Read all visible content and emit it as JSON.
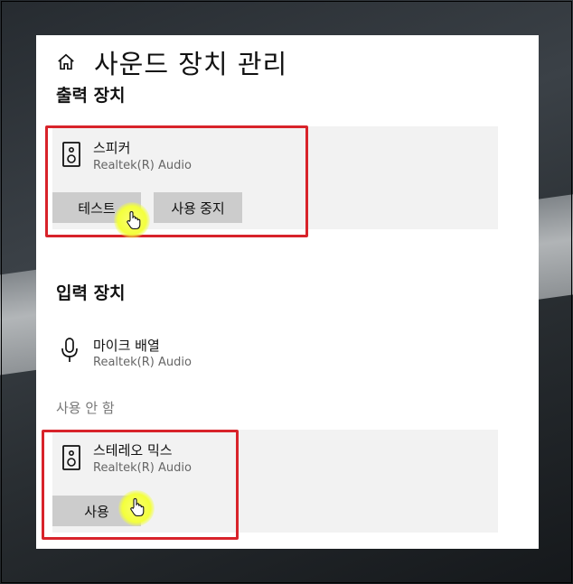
{
  "page": {
    "title": "사운드 장치 관리",
    "home_icon": "home-icon"
  },
  "output": {
    "section_title": "출력 장치",
    "device": {
      "name": "스피커",
      "driver": "Realtek(R) Audio",
      "icon": "speaker-icon",
      "buttons": {
        "test_label": "테스트",
        "disable_label": "사용 중지"
      }
    }
  },
  "input": {
    "section_title": "입력 장치",
    "device": {
      "name": "마이크 배열",
      "driver": "Realtek(R) Audio",
      "icon": "microphone-icon"
    }
  },
  "disabled": {
    "label": "사용 안 함",
    "device": {
      "name": "스테레오 믹스",
      "driver": "Realtek(R) Audio",
      "icon": "speaker-icon",
      "buttons": {
        "enable_label": "사용"
      }
    }
  },
  "colors": {
    "highlight": "#d8232a",
    "card_background": "#f2f2f2",
    "button_background": "#cccccc",
    "cursor_glow": "#f3ff3c"
  }
}
